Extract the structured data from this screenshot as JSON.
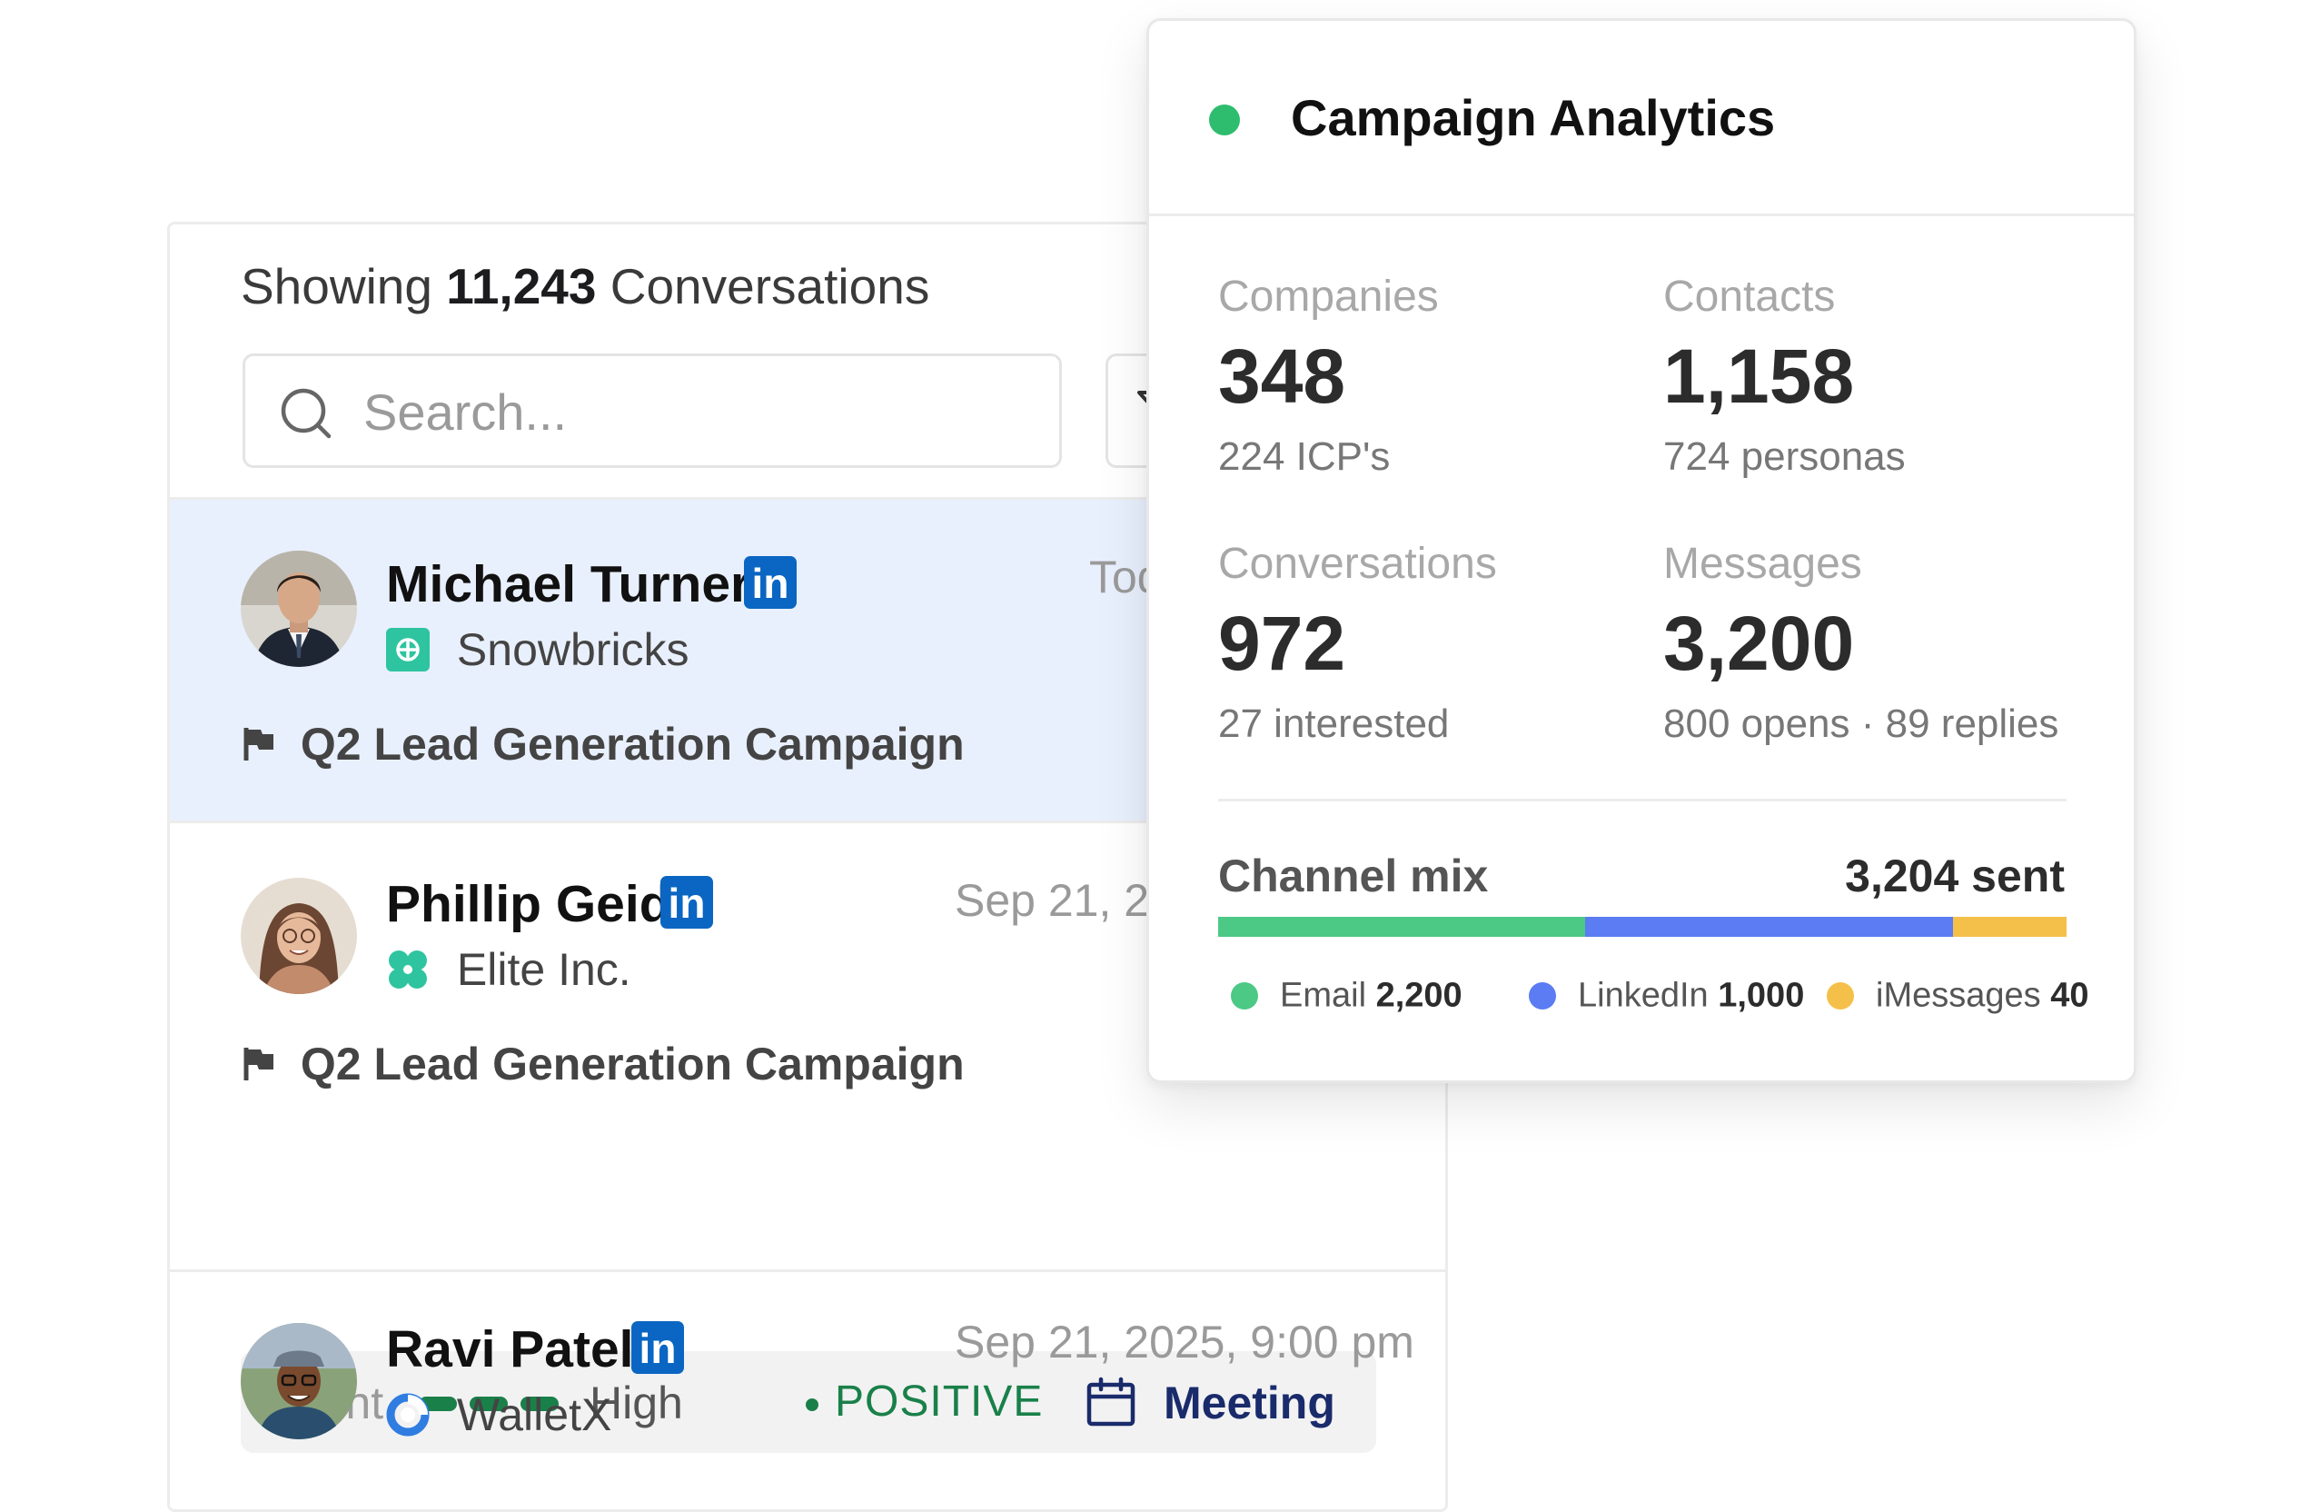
{
  "conversations": {
    "showing_prefix": "Showing",
    "count": "11,243",
    "showing_suffix": "Conversations",
    "search_placeholder": "Search...",
    "items": [
      {
        "name": "Michael Turner",
        "company": "Snowbricks",
        "timestamp": "Tod",
        "campaign": "Q2 Lead Generation Campaign",
        "selected": true
      },
      {
        "name": "Phillip Geidt",
        "company": "Elite Inc.",
        "timestamp": "Sep 21, 20",
        "campaign": "Q2 Lead Generation Campaign",
        "intent_label": "Intent",
        "intent_level": "High",
        "sentiment": "POSITIVE",
        "meeting_label": "Meeting"
      },
      {
        "name": "Ravi Patel",
        "company": "WalletX",
        "timestamp": "Sep 21, 2025, 9:00 pm"
      }
    ],
    "linkedin_badge": "in"
  },
  "analytics": {
    "title": "Campaign Analytics",
    "stats": {
      "companies": {
        "label": "Companies",
        "value": "348",
        "sub": "224 ICP's"
      },
      "contacts": {
        "label": "Contacts",
        "value": "1,158",
        "sub": "724 personas"
      },
      "conversations": {
        "label": "Conversations",
        "value": "972",
        "sub": "27 interested"
      },
      "messages": {
        "label": "Messages",
        "value": "3,200",
        "sub": "800 opens · 89 replies"
      }
    },
    "channel_mix": {
      "label": "Channel mix",
      "total": "3,204 sent",
      "channels": [
        {
          "name": "Email",
          "value": "2,200",
          "color": "#4cc985",
          "bar_share": 0.433
        },
        {
          "name": "LinkedIn",
          "value": "1,000",
          "color": "#5b7cf2",
          "bar_share": 0.433
        },
        {
          "name": "iMessages",
          "value": "40",
          "color": "#f5c04a",
          "bar_share": 0.134
        }
      ]
    }
  },
  "colors": {
    "status_green": "#2ebd6e",
    "selected_row": "#e9f0fd",
    "linkedin_blue": "#0a66c2",
    "positive_green": "#1a8049",
    "meeting_navy": "#1a2b6b"
  }
}
